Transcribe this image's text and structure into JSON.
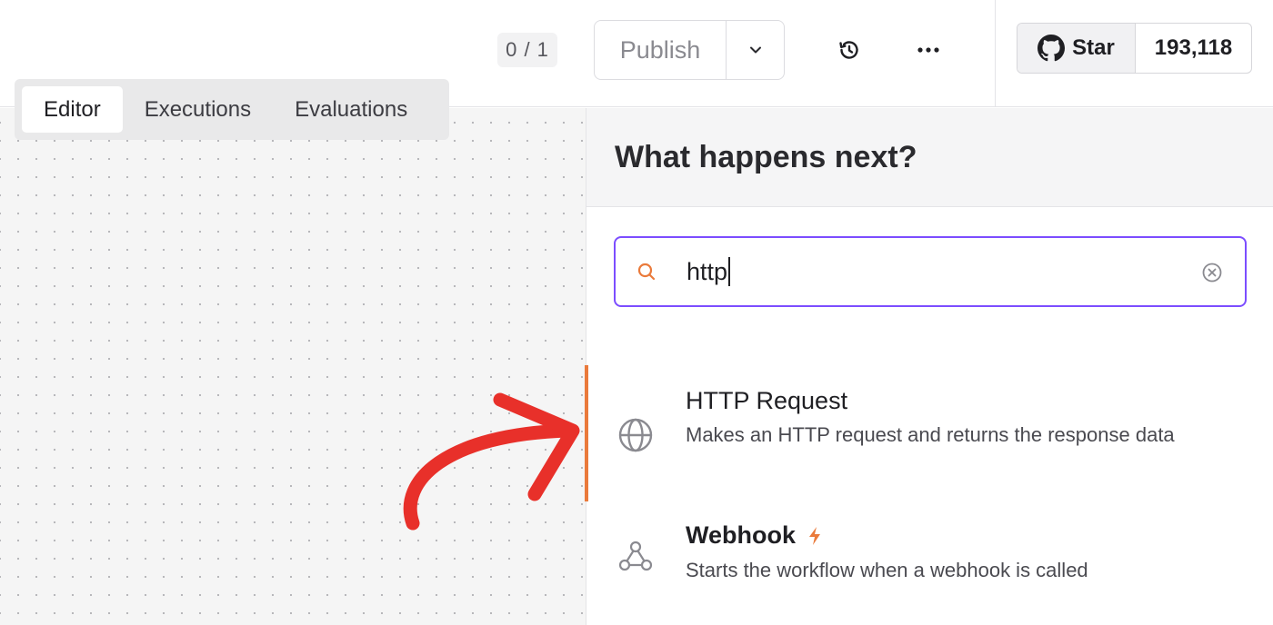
{
  "topbar": {
    "counter": "0 / 1",
    "publish_label": "Publish",
    "history_icon": "history-icon",
    "more_icon": "more-horizontal-icon",
    "github": {
      "star_label": "Star",
      "star_count": "193,118"
    }
  },
  "tabs": [
    {
      "label": "Editor",
      "active": true
    },
    {
      "label": "Executions",
      "active": false
    },
    {
      "label": "Evaluations",
      "active": false
    }
  ],
  "panel": {
    "title": "What happens next?",
    "search": {
      "value": "http"
    },
    "results": [
      {
        "title": "HTTP Request",
        "description": "Makes an HTTP request and returns the response data",
        "icon": "globe-icon",
        "highlighted": true
      },
      {
        "title": "Webhook",
        "description": "Starts the workflow when a webhook is called",
        "icon": "webhook-icon",
        "badge_icon": "lightning-icon"
      }
    ]
  },
  "colors": {
    "accent_purple": "#7c4dff",
    "accent_orange": "#ea7a3b",
    "annotation_red": "#e8302a"
  }
}
